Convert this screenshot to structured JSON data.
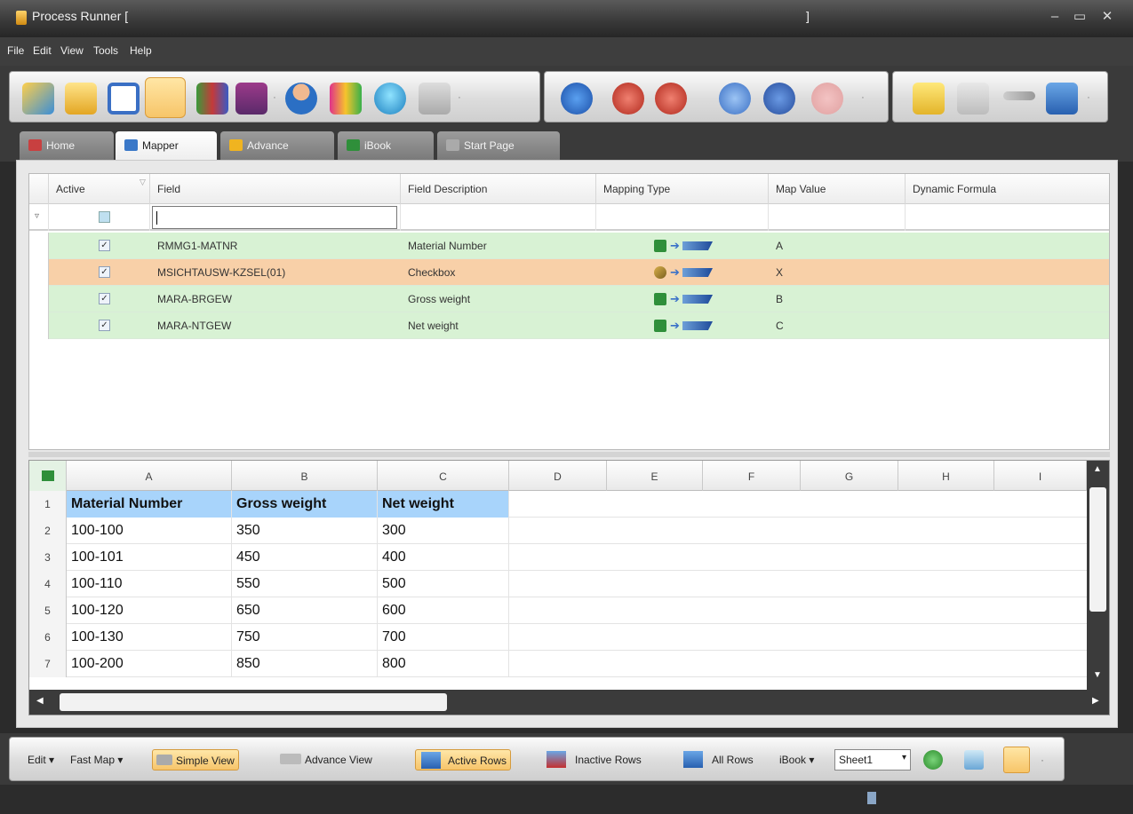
{
  "window": {
    "title": "Process Runner [",
    "title_end": "]"
  },
  "menu": [
    "File",
    "Edit",
    "View",
    "Tools",
    "Help"
  ],
  "tabs": [
    "Home",
    "Mapper",
    "Advance",
    "iBook",
    "Start Page"
  ],
  "mapper": {
    "columns": [
      "Active",
      "Field",
      "Field Description",
      "Mapping Type",
      "Map Value",
      "Dynamic Formula"
    ],
    "rows": [
      {
        "active": true,
        "field": "RMMG1-MATNR",
        "description": "Material Number",
        "map_value": "A",
        "source": "excel",
        "status": "green"
      },
      {
        "active": true,
        "field": "MSICHTAUSW-KZSEL(01)",
        "description": "Checkbox",
        "map_value": "X",
        "source": "fixed",
        "status": "orange"
      },
      {
        "active": true,
        "field": "MARA-BRGEW",
        "description": "Gross weight",
        "map_value": "B",
        "source": "excel",
        "status": "green"
      },
      {
        "active": true,
        "field": "MARA-NTGEW",
        "description": "Net weight",
        "map_value": "C",
        "source": "excel",
        "status": "green"
      }
    ]
  },
  "sheet": {
    "columns": [
      "A",
      "B",
      "C",
      "D",
      "E",
      "F",
      "G",
      "H",
      "I"
    ],
    "row_numbers": [
      "1",
      "2",
      "3",
      "4",
      "5",
      "6",
      "7"
    ],
    "header": [
      "Material Number",
      "Gross weight",
      "Net weight"
    ],
    "rows": [
      [
        "100-100",
        "350",
        "300"
      ],
      [
        "100-101",
        "450",
        "400"
      ],
      [
        "100-110",
        "550",
        "500"
      ],
      [
        "100-120",
        "650",
        "600"
      ],
      [
        "100-130",
        "750",
        "700"
      ],
      [
        "100-200",
        "850",
        "800"
      ]
    ]
  },
  "bottom": {
    "edit": "Edit ▾",
    "fast_map": "Fast Map ▾",
    "simple_view": "Simple View",
    "advance_view": "Advance View",
    "active_rows": "Active Rows",
    "inactive_rows": "Inactive Rows",
    "all_rows": "All Rows",
    "ibook": "iBook ▾",
    "sheet": "Sheet1"
  }
}
